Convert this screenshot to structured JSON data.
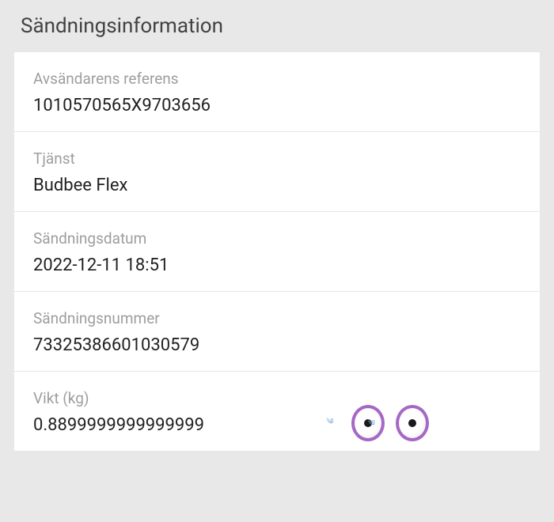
{
  "section": {
    "title": "Sändningsinformation"
  },
  "fields": {
    "sender_reference": {
      "label": "Avsändarens referens",
      "value": "1010570565X9703656"
    },
    "service": {
      "label": "Tjänst",
      "value": "Budbee Flex"
    },
    "shipment_date": {
      "label": "Sändningsdatum",
      "value": "2022-12-11 18:51"
    },
    "shipment_number": {
      "label": "Sändningsnummer",
      "value": "73325386601030579"
    },
    "weight": {
      "label": "Vikt (kg)",
      "value": "0.8899999999999999"
    }
  }
}
